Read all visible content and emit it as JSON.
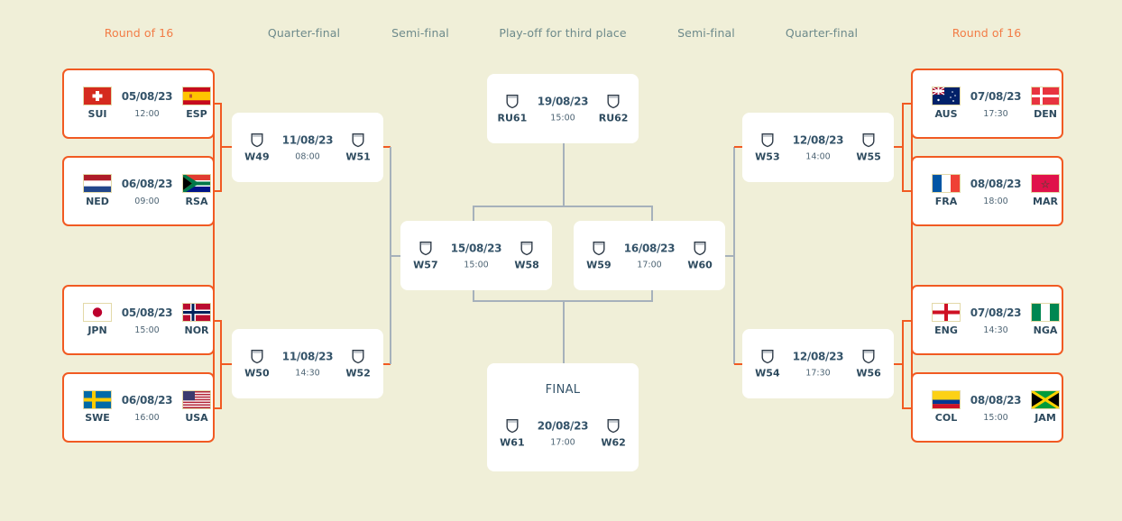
{
  "stages": {
    "left": [
      "Round of 16",
      "Quarter-final",
      "Semi-final"
    ],
    "center": "Play-off for third place",
    "right": [
      "Semi-final",
      "Quarter-final",
      "Round of 16"
    ]
  },
  "colors": {
    "background": "#f0efd8",
    "accent_orange": "#f15a22",
    "round_of_16_label": "#f27c46",
    "stage_label": "#6d8a8b",
    "connector_gray": "#a6b1bb",
    "text_dark": "#2d4a5e"
  },
  "round_of_16": {
    "left": [
      {
        "home": "SUI",
        "away": "ESP",
        "date": "05/08/23",
        "time": "12:00",
        "home_flag": "flag-switzerland",
        "away_flag": "flag-spain"
      },
      {
        "home": "NED",
        "away": "RSA",
        "date": "06/08/23",
        "time": "09:00",
        "home_flag": "flag-netherlands",
        "away_flag": "flag-south-africa"
      },
      {
        "home": "JPN",
        "away": "NOR",
        "date": "05/08/23",
        "time": "15:00",
        "home_flag": "flag-japan",
        "away_flag": "flag-norway"
      },
      {
        "home": "SWE",
        "away": "USA",
        "date": "06/08/23",
        "time": "16:00",
        "home_flag": "flag-sweden",
        "away_flag": "flag-usa"
      }
    ],
    "right": [
      {
        "home": "AUS",
        "away": "DEN",
        "date": "07/08/23",
        "time": "17:30",
        "home_flag": "flag-australia",
        "away_flag": "flag-denmark"
      },
      {
        "home": "FRA",
        "away": "MAR",
        "date": "08/08/23",
        "time": "18:00",
        "home_flag": "flag-france",
        "away_flag": "flag-morocco"
      },
      {
        "home": "ENG",
        "away": "NGA",
        "date": "07/08/23",
        "time": "14:30",
        "home_flag": "flag-england",
        "away_flag": "flag-nigeria"
      },
      {
        "home": "COL",
        "away": "JAM",
        "date": "08/08/23",
        "time": "15:00",
        "home_flag": "flag-colombia",
        "away_flag": "flag-jamaica"
      }
    ]
  },
  "quarter_finals": {
    "left": [
      {
        "home": "W49",
        "away": "W51",
        "date": "11/08/23",
        "time": "08:00"
      },
      {
        "home": "W50",
        "away": "W52",
        "date": "11/08/23",
        "time": "14:30"
      }
    ],
    "right": [
      {
        "home": "W53",
        "away": "W55",
        "date": "12/08/23",
        "time": "14:00"
      },
      {
        "home": "W54",
        "away": "W56",
        "date": "12/08/23",
        "time": "17:30"
      }
    ]
  },
  "semi_finals": {
    "left": {
      "home": "W57",
      "away": "W58",
      "date": "15/08/23",
      "time": "15:00"
    },
    "right": {
      "home": "W59",
      "away": "W60",
      "date": "16/08/23",
      "time": "17:00"
    }
  },
  "third_place": {
    "home": "RU61",
    "away": "RU62",
    "date": "19/08/23",
    "time": "15:00"
  },
  "final": {
    "label": "FINAL",
    "home": "W61",
    "away": "W62",
    "date": "20/08/23",
    "time": "17:00"
  },
  "placeholder_icon": "shield-icon"
}
